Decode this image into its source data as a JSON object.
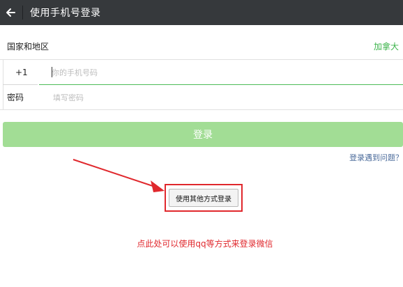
{
  "header": {
    "title": "使用手机号登录",
    "back_icon": "arrow-left-icon"
  },
  "form": {
    "country_label": "国家和地区",
    "country_value": "加拿大",
    "country_code": "+1",
    "phone_placeholder": "你的手机号码",
    "phone_value": "",
    "password_label": "密码",
    "password_placeholder": "填写密码",
    "password_value": ""
  },
  "login_button_label": "登录",
  "help_link": "登录遇到问题？",
  "other_login_button": "使用其他方式登录",
  "annotation": "点此处可以使用qq等方式来登录微信",
  "colors": {
    "titlebar": "#36393c",
    "accent_green": "#3bb34a",
    "login_button_disabled": "#a2dd95",
    "annotation_red": "#e0282d"
  }
}
